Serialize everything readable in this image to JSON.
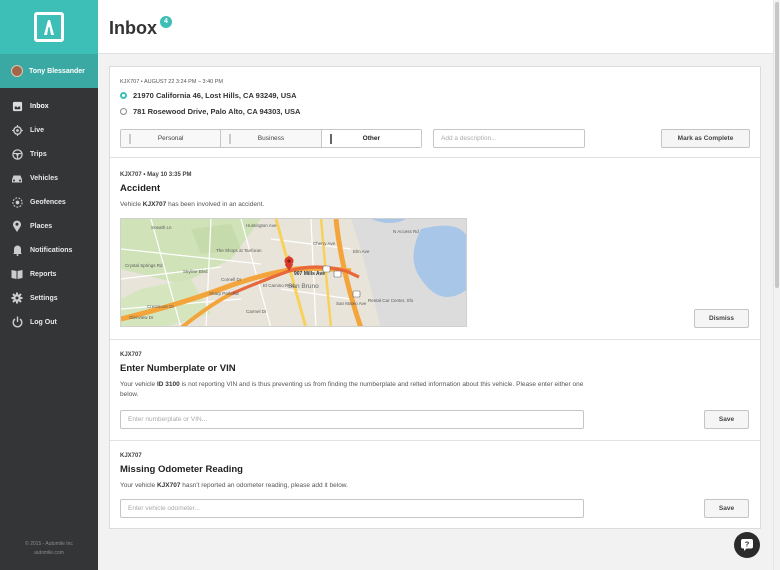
{
  "user": {
    "name": "Tony Blessander"
  },
  "nav": {
    "items": [
      {
        "label": "Inbox",
        "icon": "inbox-icon"
      },
      {
        "label": "Live",
        "icon": "crosshair-icon"
      },
      {
        "label": "Trips",
        "icon": "steering-wheel-icon"
      },
      {
        "label": "Vehicles",
        "icon": "car-icon"
      },
      {
        "label": "Geofences",
        "icon": "geofence-icon"
      },
      {
        "label": "Places",
        "icon": "map-pin-icon"
      },
      {
        "label": "Notifications",
        "icon": "bell-icon"
      },
      {
        "label": "Reports",
        "icon": "book-icon"
      },
      {
        "label": "Settings",
        "icon": "gear-icon"
      },
      {
        "label": "Log Out",
        "icon": "power-icon"
      }
    ]
  },
  "footer": {
    "copyright": "© 2015 - Automile Inc",
    "site": "automile.com"
  },
  "header": {
    "title": "Inbox",
    "badge": "4"
  },
  "trip_card": {
    "meta": "KJX707 • AUGUST 22 3:24 PM – 3:40 PM",
    "from": "21970 California 46, Lost Hills, CA 93249, USA",
    "to": "781 Rosewood Drive, Palo Alto, CA 94303, USA",
    "segments": [
      "Personal",
      "Business",
      "Other"
    ],
    "description_placeholder": "Add a description...",
    "mark_label": "Mark as Complete"
  },
  "accident_card": {
    "meta": "KJX707 • May 10 3:35 PM",
    "title": "Accident",
    "text_pre": "Vehicle ",
    "text_vehicle": "KJX707",
    "text_post": " has been involved in an accident.",
    "map": {
      "pin_label": "907 Mills Ave",
      "city_label": "San Bruno",
      "labels": [
        "The Shops at Tanforan",
        "Rental Car Center, Sfo",
        "N Access Rd",
        "Sneath Ln",
        "Crystal Springs Rd",
        "Skyline Blvd",
        "Cherry Ave",
        "Huntington Ave",
        "San Mateo Ave",
        "Sharp Park Rd",
        "Crestmoor Dr",
        "Glenview Dr",
        "Carmel Dr",
        "El Camino Real",
        "Elm Ave",
        "Cornell Dr"
      ],
      "shields": [
        "380",
        "82",
        "101"
      ]
    },
    "dismiss_label": "Dismiss"
  },
  "vin_card": {
    "meta": "KJX707",
    "title": "Enter Numberplate or VIN",
    "text_pre": "Your vehicle ",
    "text_vehicle": "ID 3100",
    "text_post": " is not reporting VIN and is thus preventing us from finding the numberplate and relted information about this vehicle. Please enter either one below.",
    "placeholder": "Enter numberplate or VIN...",
    "save_label": "Save"
  },
  "odometer_card": {
    "meta": "KJX707",
    "title": "Missing Odometer Reading",
    "text_pre": "Your vehicle ",
    "text_vehicle": "KJX707",
    "text_post": " hasn't reported an odometer reading, please add it below.",
    "placeholder": "Enter vehicle odometer...",
    "save_label": "Save"
  },
  "colors": {
    "accent": "#3dbfb8",
    "sidebar": "#333537"
  }
}
